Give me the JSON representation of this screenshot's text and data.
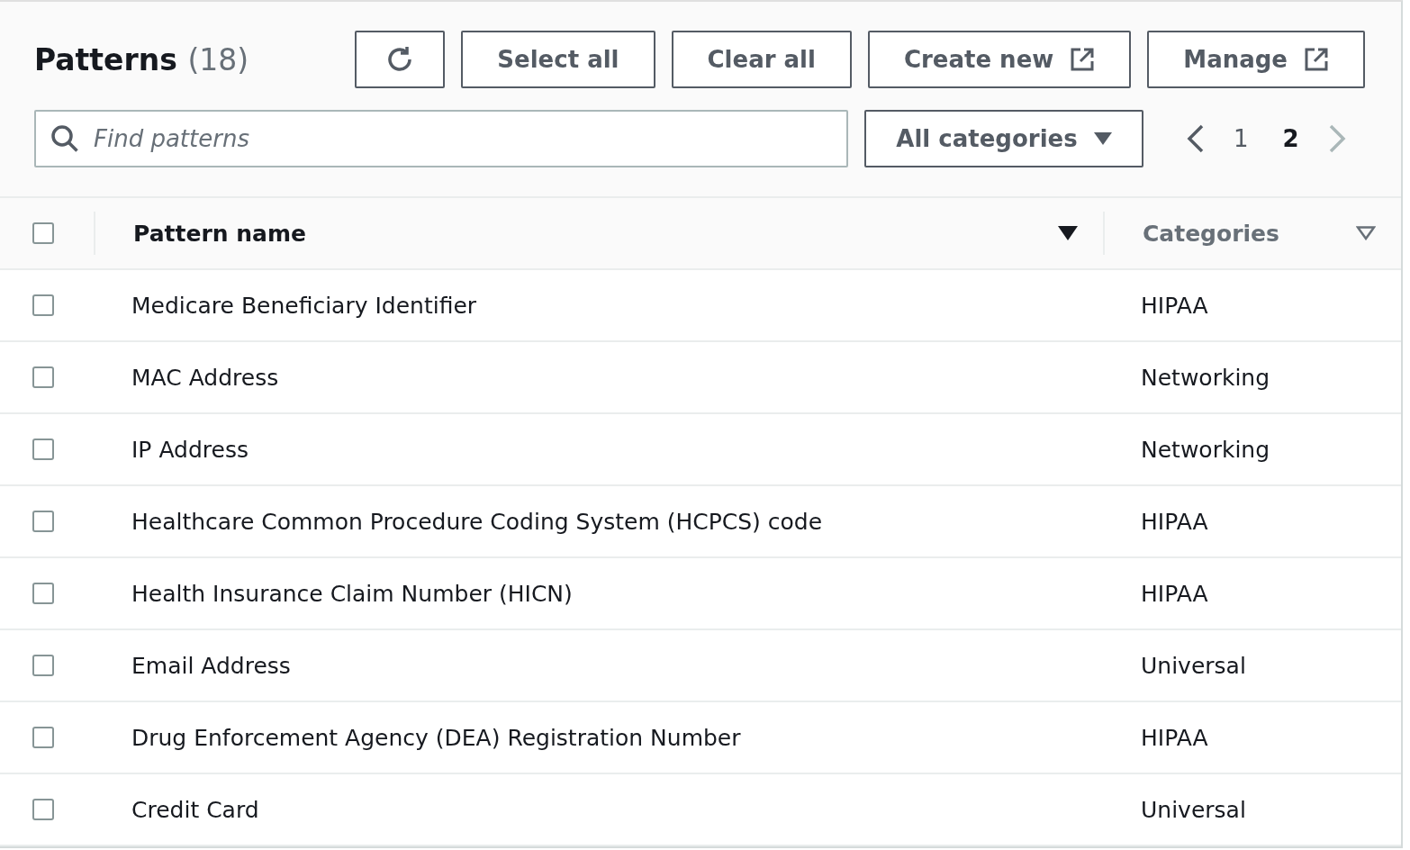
{
  "header": {
    "title": "Patterns",
    "count": "(18)",
    "buttons": [
      {
        "kind": "refresh"
      },
      {
        "kind": "text",
        "label": "Select all"
      },
      {
        "kind": "text",
        "label": "Clear all"
      },
      {
        "kind": "external",
        "label": "Create new"
      },
      {
        "kind": "external",
        "label": "Manage"
      }
    ],
    "search": {
      "placeholder": "Find patterns"
    },
    "category_filter": {
      "label": "All categories"
    },
    "pagination": {
      "previous": {
        "disabled": false
      },
      "pages": [
        {
          "label": "1",
          "selected": false
        },
        {
          "label": "2",
          "selected": true
        }
      ],
      "next": {
        "disabled": true
      }
    }
  },
  "table": {
    "select_all_checked": false,
    "columns": [
      {
        "label": "Pattern name",
        "sorted": true
      },
      {
        "label": "Categories",
        "sorted": false
      }
    ],
    "rows": [
      {
        "name": "Medicare Beneficiary Identifier",
        "category": "HIPAA",
        "checked": false
      },
      {
        "name": "MAC Address",
        "category": "Networking",
        "checked": false
      },
      {
        "name": "IP Address",
        "category": "Networking",
        "checked": false
      },
      {
        "name": "Healthcare Common Procedure Coding System (HCPCS) code",
        "category": "HIPAA",
        "checked": false
      },
      {
        "name": "Health Insurance Claim Number (HICN)",
        "category": "HIPAA",
        "checked": false
      },
      {
        "name": "Email Address",
        "category": "Universal",
        "checked": false
      },
      {
        "name": "Drug Enforcement Agency (DEA) Registration Number",
        "category": "HIPAA",
        "checked": false
      },
      {
        "name": "Credit Card",
        "category": "Universal",
        "checked": false
      }
    ]
  }
}
